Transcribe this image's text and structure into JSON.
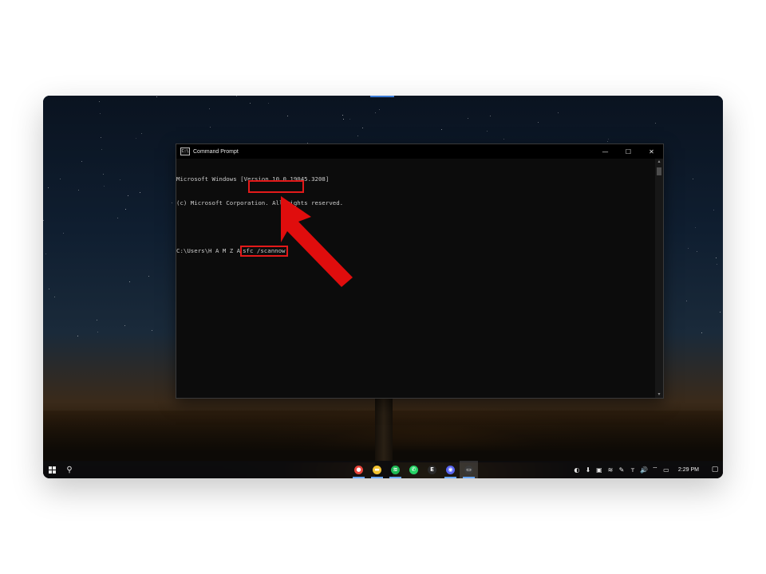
{
  "cmd": {
    "title": "Command Prompt",
    "icon_label": "C:\\",
    "lines": [
      "Microsoft Windows [Version 10.0.19045.3208]",
      "(c) Microsoft Corporation. All rights reserved."
    ],
    "prompt": "C:\\Users\\H A M Z A",
    "command": "sfc /scannow",
    "controls": {
      "minimize": "—",
      "maximize": "☐",
      "close": "✕"
    }
  },
  "taskbar": {
    "start_icon": "windows-logo-icon",
    "search_icon": "search-icon",
    "apps": [
      {
        "name": "chrome-icon",
        "glyph": "●",
        "color": "#e8453c",
        "active": true,
        "focused": false
      },
      {
        "name": "file-explorer-icon",
        "glyph": "▬",
        "color": "#f2c230",
        "active": true,
        "focused": false
      },
      {
        "name": "spotify-icon",
        "glyph": "≋",
        "color": "#1db954",
        "active": true,
        "focused": false
      },
      {
        "name": "whatsapp-icon",
        "glyph": "✆",
        "color": "#25d366",
        "active": false,
        "focused": false
      },
      {
        "name": "epic-games-icon",
        "glyph": "E",
        "color": "#2a2a2a",
        "active": false,
        "focused": false
      },
      {
        "name": "discord-icon",
        "glyph": "◉",
        "color": "#5865f2",
        "active": true,
        "focused": false
      },
      {
        "name": "command-prompt-icon",
        "glyph": "▭",
        "color": "#3a3a3a",
        "active": true,
        "focused": true
      }
    ],
    "tray": {
      "icons": [
        "discord-tray-icon",
        "download-arrow-icon",
        "nvidia-icon",
        "spotify-tray-icon",
        "hardware-tray-icon",
        "language-tray-icon",
        "volume-icon",
        "network-icon",
        "display-icon"
      ],
      "time": "2:29 PM",
      "notification_icon": "notification-icon"
    }
  }
}
